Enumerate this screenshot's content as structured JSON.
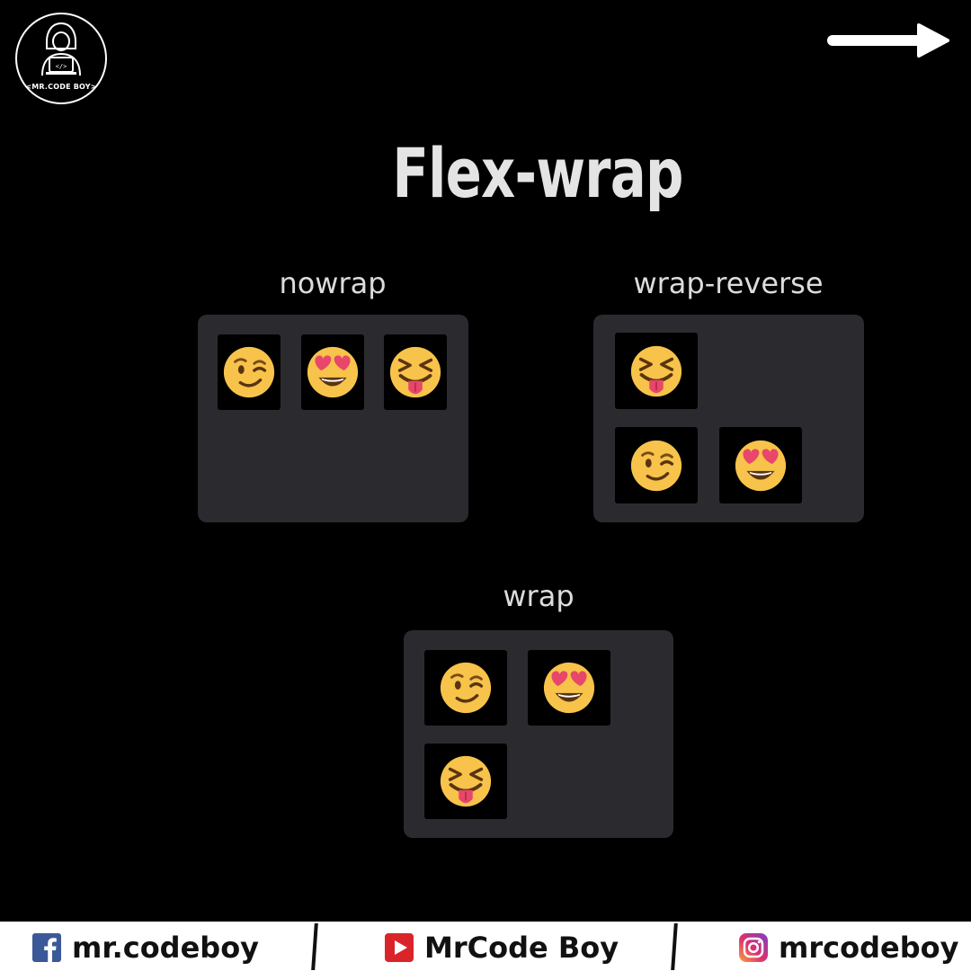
{
  "brand": {
    "logo_text": "<MR.CODE BOY>"
  },
  "title": "Flex-wrap",
  "panels": {
    "nowrap": {
      "label": "nowrap",
      "items": [
        "wink",
        "heart-eyes",
        "tongue"
      ]
    },
    "wrap_reverse": {
      "label": "wrap-reverse",
      "items": [
        "tongue",
        "wink",
        "heart-eyes"
      ]
    },
    "wrap": {
      "label": "wrap",
      "items": [
        "wink",
        "heart-eyes",
        "tongue"
      ]
    }
  },
  "footer": {
    "facebook": "mr.codeboy",
    "youtube": "MrCode Boy",
    "instagram": "mrcodeboy"
  },
  "colors": {
    "background": "#000000",
    "panel": "#2b2b2f",
    "emoji": "#f7c34a",
    "heart": "#e8466a",
    "footer": "#ffffff"
  }
}
